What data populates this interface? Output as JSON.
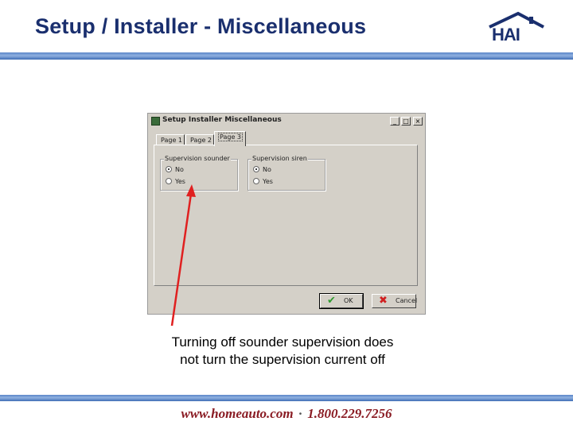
{
  "slide": {
    "title": "Setup / Installer - Miscellaneous",
    "logo_text": "HAI",
    "caption_line1": "Turning off sounder supervision does",
    "caption_line2": "not turn the supervision current off",
    "footer_url": "www.homeauto.com",
    "footer_sep": "·",
    "footer_phone": "1.800.229.7256"
  },
  "dialog": {
    "title": "Setup Installer Miscellaneous",
    "window_buttons": {
      "minimize": "_",
      "maximize": "□",
      "close": "×"
    },
    "tabs": [
      {
        "label": "Page 1",
        "active": false
      },
      {
        "label": "Page 2",
        "active": false
      },
      {
        "label": "Page 3",
        "active": true
      }
    ],
    "groups": [
      {
        "title": "Supervision sounder",
        "options": [
          {
            "label": "No",
            "checked": true
          },
          {
            "label": "Yes",
            "checked": false
          }
        ]
      },
      {
        "title": "Supervision siren",
        "options": [
          {
            "label": "No",
            "checked": true
          },
          {
            "label": "Yes",
            "checked": false
          }
        ]
      }
    ],
    "buttons": {
      "ok": "OK",
      "cancel": "Cancel"
    }
  },
  "colors": {
    "title_blue": "#1a2f6e",
    "footer_red": "#8a1c24",
    "arrow_red": "#e02020",
    "dialog_gray": "#d4d0c8"
  }
}
